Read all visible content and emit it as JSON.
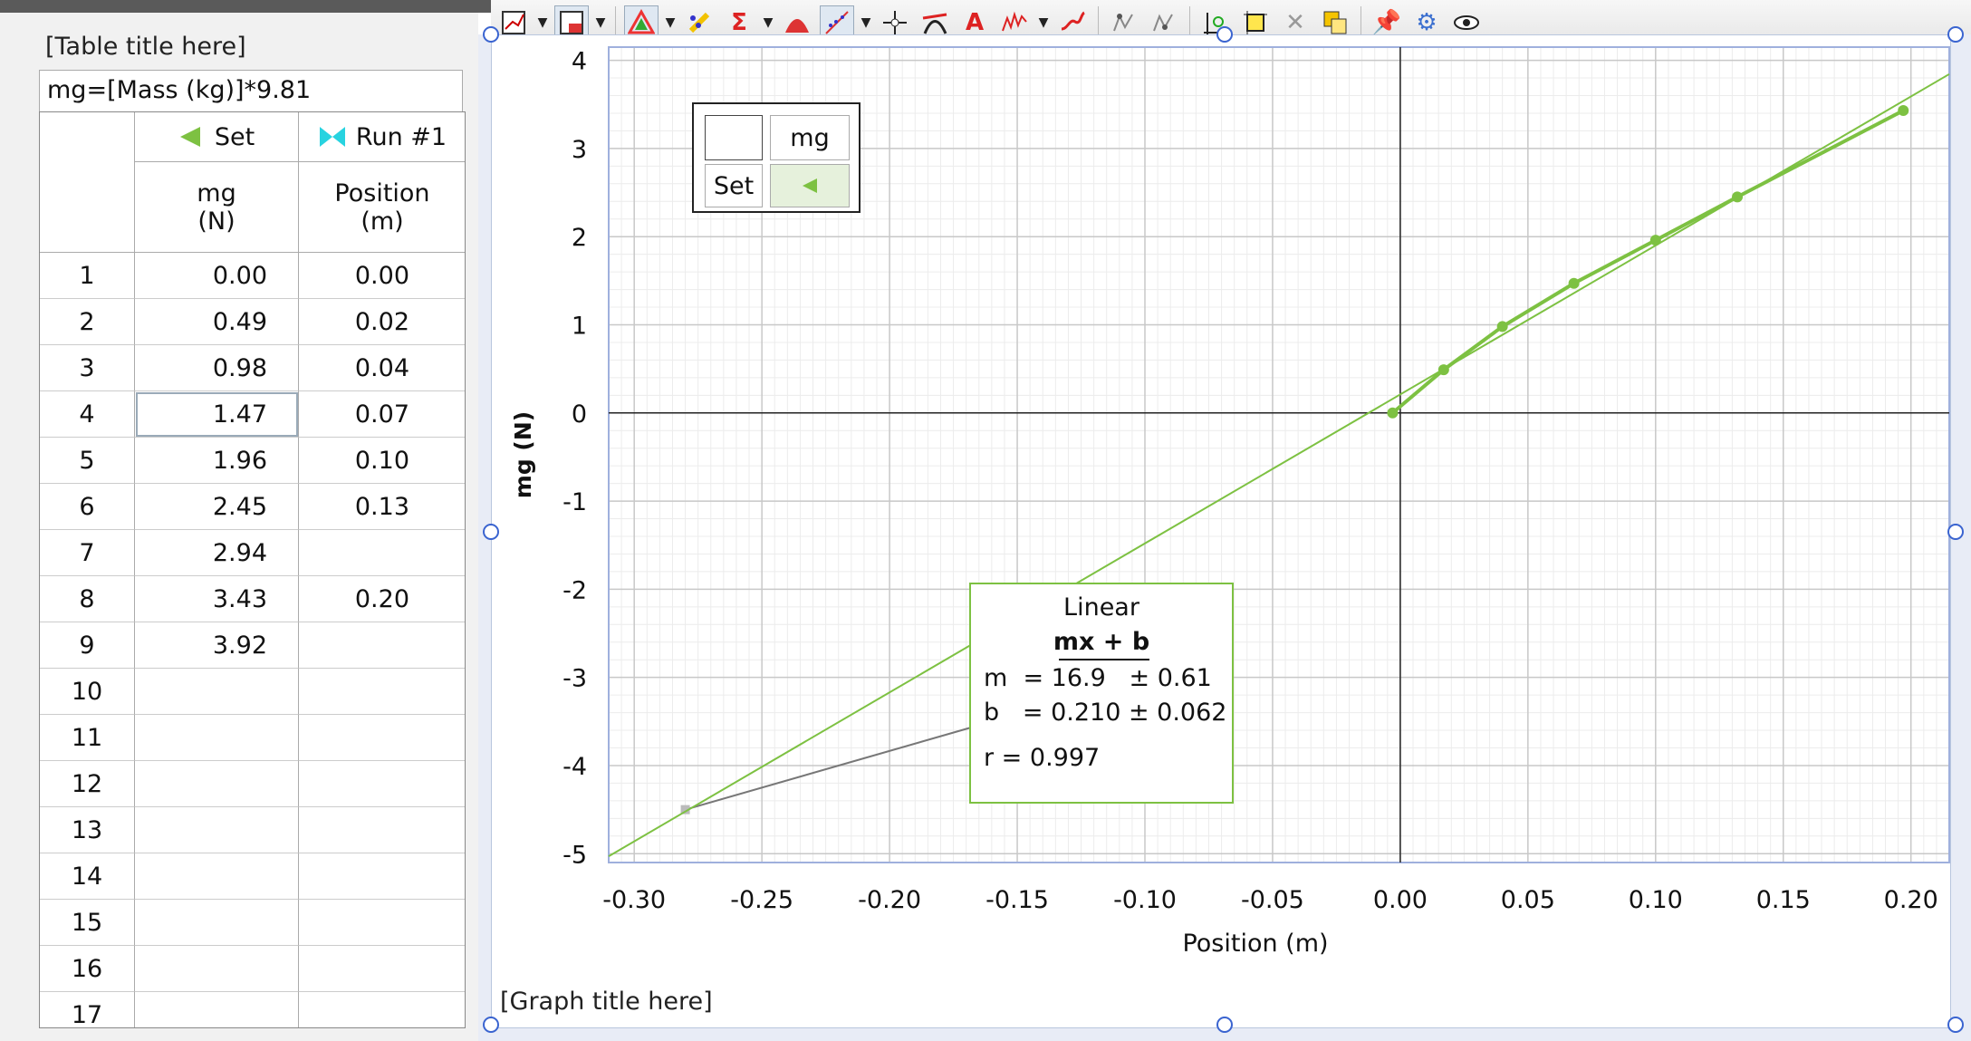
{
  "toolbar": {
    "icons": [
      "graph-options-icon",
      "insert-graph-icon",
      "color-triangle-icon",
      "highlighter-icon",
      "statistics-sigma-icon",
      "integral-area-icon",
      "curve-fit-icon",
      "examine-crosshair-icon",
      "tangent-icon",
      "annotation-text-icon",
      "model-icon",
      "interpolate-icon",
      "delete-point-icon",
      "delete-point-2-icon",
      "autoscale-icon",
      "zoom-box-icon",
      "remove-icon",
      "duplicate-icon",
      "pin-icon",
      "settings-gear-icon",
      "eye-icon"
    ]
  },
  "table": {
    "title": "[Table title here]",
    "formula": "mg=[Mass (kg)]*9.81",
    "columns": [
      {
        "group": "Set",
        "name": "mg",
        "unit": "(N)"
      },
      {
        "group": "Run #1",
        "name": "Position",
        "unit": "(m)"
      }
    ],
    "rows": [
      {
        "n": "1",
        "mg": "0.00",
        "pos": "0.00"
      },
      {
        "n": "2",
        "mg": "0.49",
        "pos": "0.02"
      },
      {
        "n": "3",
        "mg": "0.98",
        "pos": "0.04"
      },
      {
        "n": "4",
        "mg": "1.47",
        "pos": "0.07"
      },
      {
        "n": "5",
        "mg": "1.96",
        "pos": "0.10"
      },
      {
        "n": "6",
        "mg": "2.45",
        "pos": "0.13"
      },
      {
        "n": "7",
        "mg": "2.94",
        "pos": ""
      },
      {
        "n": "8",
        "mg": "3.43",
        "pos": "0.20"
      },
      {
        "n": "9",
        "mg": "3.92",
        "pos": ""
      },
      {
        "n": "10",
        "mg": "",
        "pos": ""
      },
      {
        "n": "11",
        "mg": "",
        "pos": ""
      },
      {
        "n": "12",
        "mg": "",
        "pos": ""
      },
      {
        "n": "13",
        "mg": "",
        "pos": ""
      },
      {
        "n": "14",
        "mg": "",
        "pos": ""
      },
      {
        "n": "15",
        "mg": "",
        "pos": ""
      },
      {
        "n": "16",
        "mg": "",
        "pos": ""
      },
      {
        "n": "17",
        "mg": "",
        "pos": ""
      }
    ],
    "selected_row": "4"
  },
  "graph": {
    "title": "[Graph title here]",
    "legend": {
      "header": "mg",
      "set_label": "Set"
    },
    "fit_box": {
      "title": "Linear",
      "equation": "mx + b",
      "m_line": "m  = 16.9   ± 0.61",
      "b_line": "b   = 0.210 ± 0.062",
      "r_line": "r = 0.997"
    },
    "colors": {
      "series": "#7dc142",
      "fit": "#7dc142",
      "axis": "#222222",
      "grid_major": "#c8c8c8",
      "grid_minor": "#ececec",
      "leader": "#777777"
    }
  },
  "chart_data": {
    "type": "scatter",
    "title": "[Graph title here]",
    "xlabel": "Position (m)",
    "ylabel": "mg (N)",
    "xlim": [
      -0.31,
      0.215
    ],
    "ylim": [
      -5.1,
      4.15
    ],
    "xticks": [
      "-0.30",
      "-0.25",
      "-0.20",
      "-0.15",
      "-0.10",
      "-0.05",
      "0.00",
      "0.05",
      "0.10",
      "0.15",
      "0.20"
    ],
    "yticks": [
      "-5",
      "-4",
      "-3",
      "-2",
      "-1",
      "0",
      "1",
      "2",
      "3",
      "4"
    ],
    "grid": true,
    "series": [
      {
        "name": "mg",
        "x": [
          -0.003,
          0.017,
          0.04,
          0.068,
          0.1,
          0.132,
          0.197
        ],
        "y": [
          0.0,
          0.49,
          0.98,
          1.47,
          1.96,
          2.45,
          3.43
        ]
      }
    ],
    "fit": {
      "type": "linear",
      "m": 16.9,
      "b": 0.21,
      "r": 0.997
    },
    "leader_anchor": [
      -0.28,
      -4.5
    ]
  }
}
